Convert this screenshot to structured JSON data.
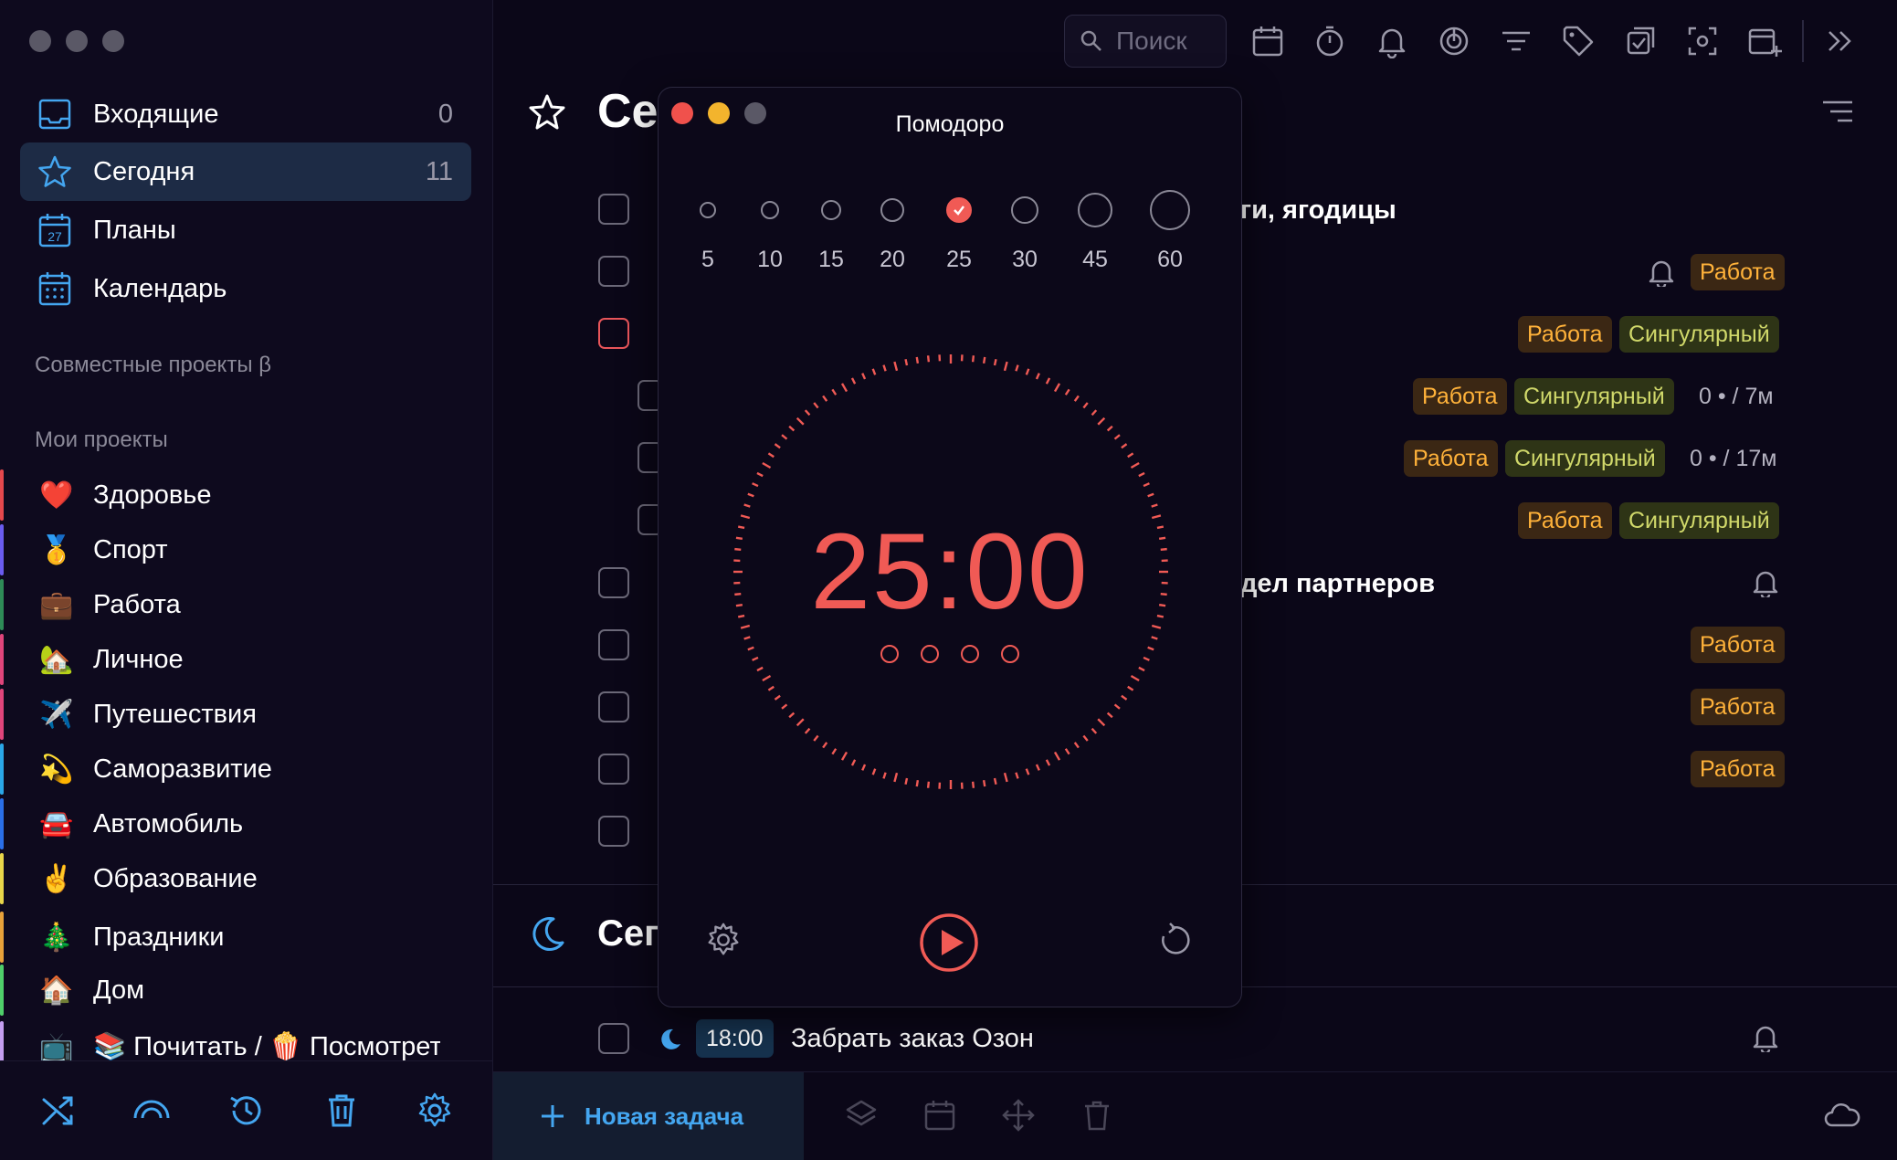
{
  "sidebar": {
    "nav": [
      {
        "label": "Входящие",
        "count": "0",
        "icon": "inbox-icon"
      },
      {
        "label": "Сегодня",
        "count": "11",
        "icon": "star-icon"
      },
      {
        "label": "Планы",
        "count": "",
        "icon": "calendar-27-icon"
      },
      {
        "label": "Календарь",
        "count": "",
        "icon": "calendar-grid-icon"
      }
    ],
    "shared_projects_header": "Совместные проекты β",
    "my_projects_header": "Мои проекты",
    "projects": [
      {
        "emoji": "❤️",
        "label": "Здоровье",
        "color": "#e5484d"
      },
      {
        "emoji": "🥇",
        "label": "Спорт",
        "color": "#6a5cf0"
      },
      {
        "emoji": "💼",
        "label": "Работа",
        "color": "#2e8b57"
      },
      {
        "emoji": "🏡",
        "label": "Личное",
        "color": "#e0457b"
      },
      {
        "emoji": "✈️",
        "label": "Путешествия",
        "color": "#e0457b"
      },
      {
        "emoji": "💫",
        "label": "Саморазвитие",
        "color": "#2aa7e8"
      },
      {
        "emoji": "🚘",
        "label": "Автомобиль",
        "color": "#2a6fe8"
      },
      {
        "emoji": "✌️",
        "label": "Образование",
        "color": "#e8d64a"
      },
      {
        "emoji": "🎄",
        "label": "Праздники",
        "color": "#e8a23a"
      },
      {
        "emoji": "🏠",
        "label": "Дом",
        "color": "#4fcf6a"
      },
      {
        "emoji": "📺",
        "label": "📚 Почитать / 🍿 Посмотреть",
        "color": "#c49ef0"
      }
    ]
  },
  "toolbar": {
    "search_placeholder": "Поиск"
  },
  "main": {
    "today_title": "Сегодня",
    "today_title_visible": "Се",
    "tasks": [
      {
        "text": "ги, ягодицы"
      },
      {
        "tags": [
          "Работа"
        ]
      },
      {
        "tags": [
          "Работа",
          "Сингулярный"
        ]
      },
      {
        "tags": [
          "Работа",
          "Сингулярный"
        ],
        "meta": "0 • / 7м"
      },
      {
        "tags": [
          "Работа",
          "Сингулярный"
        ],
        "meta": "0 • / 17м"
      },
      {
        "tags": [
          "Работа",
          "Сингулярный"
        ]
      },
      {
        "text": "дел партнеров"
      },
      {
        "tags": [
          "Работа"
        ]
      },
      {
        "tags": [
          "Работа"
        ]
      },
      {
        "tags": [
          "Работа"
        ]
      }
    ],
    "tag_work": "Работа",
    "tag_singular": "Сингулярный",
    "meta_1": "0 • / 7м",
    "meta_2": "0 • / 17м",
    "task_text_1": "ги, ягодицы",
    "task_text_2": "дел партнеров",
    "evening_title_visible": "Сег",
    "evening_task": {
      "time": "18:00",
      "text": "Забрать заказ Озон"
    },
    "new_task_label": "Новая задача"
  },
  "pomodoro": {
    "title": "Помодоро",
    "durations": [
      "5",
      "10",
      "15",
      "20",
      "25",
      "30",
      "45",
      "60"
    ],
    "selected_duration": "25",
    "timer": "25:00",
    "sessions": 4,
    "accent_color": "#f05a55"
  },
  "colors": {
    "background": "#0b0718",
    "accent_blue": "#44a6f0",
    "tag_work": "#ffb23a",
    "tag_singular": "#d0d86a"
  }
}
